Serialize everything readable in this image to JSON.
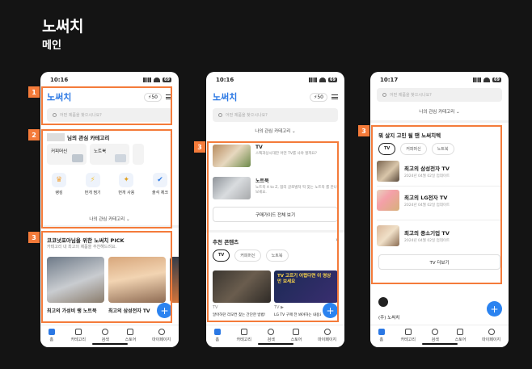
{
  "header": {
    "title": "노써치",
    "subtitle": "메인"
  },
  "common": {
    "logo": "노써치",
    "points": "⚡50",
    "search_placeholder": "어떤 제품을 찾으시나요?",
    "tabs": [
      "홈",
      "카테고리",
      "검색",
      "스토어",
      "마이페이지"
    ],
    "fab": "+",
    "accent_color": "#f47b3a",
    "brand_color": "#2b78e4"
  },
  "phone1": {
    "time": "10:16",
    "battery": "69",
    "badges": [
      "1",
      "2",
      "3"
    ],
    "category_title": "님의 관심 카테고리",
    "chips": [
      "커피머신",
      "노트북"
    ],
    "icons": [
      {
        "label": "랭킹",
        "icon": "trophy-icon"
      },
      {
        "label": "번개 찜기",
        "icon": "lightning-icon"
      },
      {
        "label": "번개 사용",
        "icon": "gift-icon"
      },
      {
        "label": "출석 체크",
        "icon": "calendar-icon"
      }
    ],
    "my_category_link": "나의 관심 카테고리 ⌄",
    "pick_title": "코코넛포아님을 위한 노써치 PICK",
    "pick_sub": "카테고리 내 최고의 제품을 추천해드려요.",
    "cards": [
      "최고의 가성비 랭 노트북",
      "최고의 삼성전자 TV"
    ]
  },
  "phone2": {
    "time": "10:16",
    "battery": "69",
    "badge": "3",
    "my_category_link": "나의 관심 카테고리 ⌄",
    "guides": [
      {
        "title": "TV",
        "desc": "스펙과상시대한 어떤 TV를 사야 할까요?"
      },
      {
        "title": "노트북",
        "desc": "노트북 A to Z, 합리 글로벌처 딱 맞는 노트북 를 만나보세요."
      }
    ],
    "guide_button": "구매가이드 전체 보기",
    "recommend_title": "추천 콘텐츠",
    "pills": [
      "TV",
      "커피머신",
      "노트북"
    ],
    "video_caption_right": "TV 고르기 어렵다면 이 영상만 보세요",
    "bottom_left_tag": "TV",
    "bottom_right_tag": "TV ▶",
    "bottom_left": "알아하던 리모컨 찾는 간단한 방법!",
    "bottom_right": "LG TV 구매 전 봐야하는 내용요..."
  },
  "phone3": {
    "time": "10:17",
    "battery": "69",
    "badge": "3",
    "my_category_link": "나의 관심 카테고리 ⌄",
    "ranking_title": "뭐 살지 고민 될 땐 노써치텍",
    "pills": [
      "TV",
      "커피머신",
      "노트북"
    ],
    "items": [
      {
        "title": "최고의 삼성전자 TV",
        "date": "2024년 04월 02일 업데이트"
      },
      {
        "title": "최고의 LG전자 TV",
        "date": "2024년 04월 02일 업데이트"
      },
      {
        "title": "최고의 중소기업 TV",
        "date": "2024년 04월 02일 업데이트"
      }
    ],
    "more_button": "TV 더보기",
    "footer_brand": "(주) 노써치"
  }
}
